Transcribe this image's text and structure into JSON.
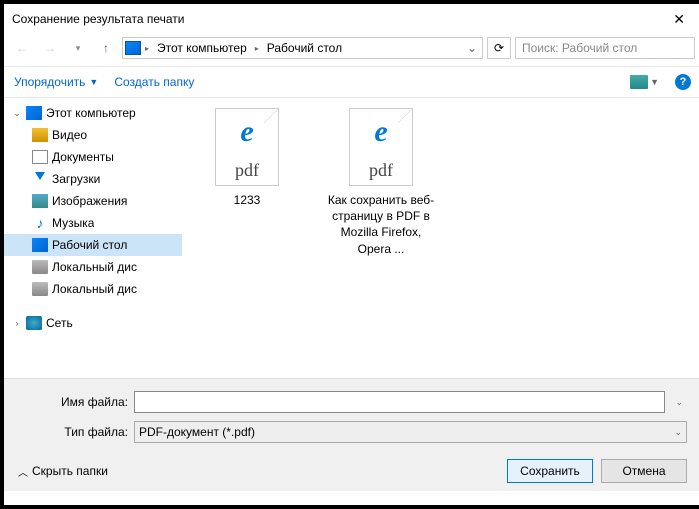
{
  "title": "Сохранение результата печати",
  "breadcrumb": [
    "Этот компьютер",
    "Рабочий стол"
  ],
  "search_placeholder": "Поиск: Рабочий стол",
  "toolbar": {
    "organize": "Упорядочить",
    "new_folder": "Создать папку"
  },
  "sidebar": {
    "this_pc": "Этот компьютер",
    "videos": "Видео",
    "documents": "Документы",
    "downloads": "Загрузки",
    "pictures": "Изображения",
    "music": "Музыка",
    "desktop": "Рабочий стол",
    "local_disk1": "Локальный дис",
    "local_disk2": "Локальный дис",
    "network": "Сеть"
  },
  "files": [
    {
      "name": "1233",
      "type": "pdf"
    },
    {
      "name": "Как сохранить веб-страницу в PDF в Mozilla Firefox, Opera ...",
      "type": "pdf"
    }
  ],
  "fields": {
    "filename_label": "Имя файла:",
    "filename_value": "",
    "filetype_label": "Тип файла:",
    "filetype_value": "PDF-документ (*.pdf)"
  },
  "actions": {
    "hide_folders": "Скрыть папки",
    "save": "Сохранить",
    "cancel": "Отмена"
  }
}
